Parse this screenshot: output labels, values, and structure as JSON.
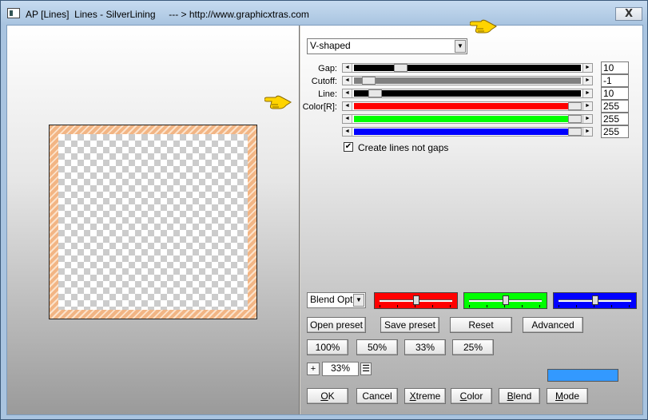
{
  "window": {
    "title": "AP [Lines]  Lines - SilverLining     --- > http://www.graphicxtras.com",
    "close_label": "X"
  },
  "effect_dropdown": {
    "value": "V-shaped"
  },
  "params": [
    {
      "label": "Gap:",
      "value": "10",
      "fill_color": "#000000",
      "position_fraction": 0.19
    },
    {
      "label": "Cutoff:",
      "value": "-1",
      "fill_color": "#808080",
      "position_fraction": 0.04
    },
    {
      "label": "Line:",
      "value": "10",
      "fill_color": "#000000",
      "position_fraction": 0.07
    },
    {
      "label": "Color[R]:",
      "value": "255",
      "fill_color": "#ff0000",
      "position_fraction": 1.0
    },
    {
      "label": "",
      "value": "255",
      "fill_color": "#00ff00",
      "position_fraction": 1.0
    },
    {
      "label": "",
      "value": "255",
      "fill_color": "#0000ff",
      "position_fraction": 1.0
    }
  ],
  "create_lines": {
    "label": "Create lines not gaps",
    "checked": true,
    "check_glyph": "✔"
  },
  "blend": {
    "dropdown_value": "Blend Opti",
    "sliders": [
      {
        "color": "#ff0000",
        "position_fraction": 0.5
      },
      {
        "color": "#00ff00",
        "position_fraction": 0.5
      },
      {
        "color": "#0000ff",
        "position_fraction": 0.5
      }
    ]
  },
  "preset_buttons": [
    "Open preset",
    "Save preset",
    "Reset",
    "Advanced"
  ],
  "zoom_buttons": [
    "100%",
    "50%",
    "33%",
    "25%"
  ],
  "zoom": {
    "plus_label": "+",
    "value": "33%"
  },
  "accent_swatch_color": "#3399ff",
  "bottom_buttons": {
    "ok": {
      "hot": "O",
      "rest": "K"
    },
    "cancel": "Cancel",
    "xtreme": {
      "hot": "X",
      "rest": "treme"
    },
    "color": {
      "hot": "C",
      "rest": "olor"
    },
    "blend": {
      "hot": "B",
      "rest": "lend"
    },
    "mode": {
      "hot": "M",
      "rest": "ode"
    }
  },
  "icons": {
    "app": "app-icon",
    "pointer_hand": "pointing-hand-icon",
    "dropdown": "chevron-down-icon"
  },
  "colors": {
    "checker_light": "#ffffff",
    "checker_dark": "#cccccc",
    "frame_stripe": "#f2b584"
  }
}
